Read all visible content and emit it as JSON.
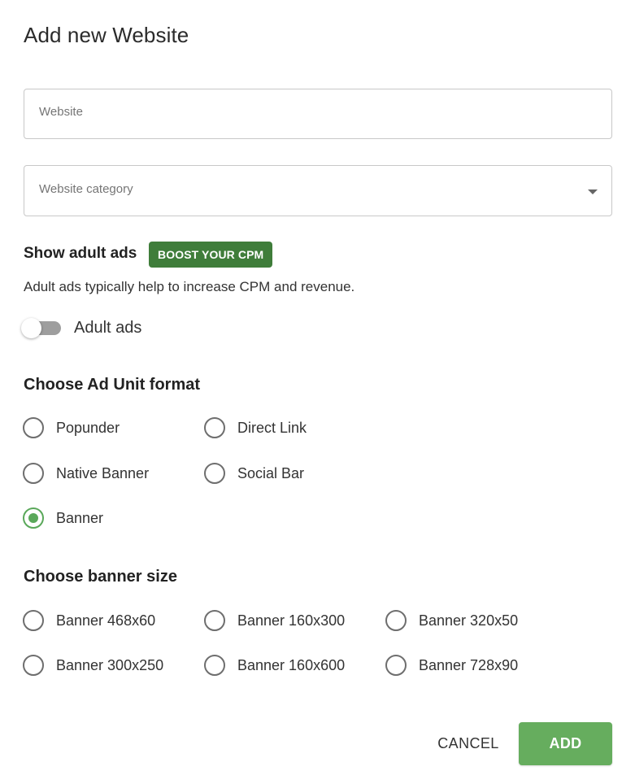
{
  "dialog": {
    "title": "Add new Website"
  },
  "form": {
    "website_placeholder": "Website",
    "category_placeholder": "Website category"
  },
  "adult": {
    "heading": "Show adult ads",
    "badge": "BOOST YOUR CPM",
    "description": "Adult ads typically help to increase CPM and revenue.",
    "toggle_label": "Adult ads",
    "toggle_on": false
  },
  "ad_format": {
    "heading": "Choose Ad Unit format",
    "options": [
      "Popunder",
      "Direct Link",
      "Native Banner",
      "Social Bar",
      "Banner"
    ],
    "selected": "Banner"
  },
  "banner_size": {
    "heading": "Choose banner size",
    "options": [
      "Banner 468x60",
      "Banner 160x300",
      "Banner 320x50",
      "Banner 300x250",
      "Banner 160x600",
      "Banner 728x90"
    ],
    "selected": null
  },
  "actions": {
    "cancel_label": "CANCEL",
    "add_label": "ADD"
  },
  "colors": {
    "accent_green": "#66ad5e",
    "badge_green": "#3f7d3a",
    "radio_selected": "#5aa85a"
  }
}
